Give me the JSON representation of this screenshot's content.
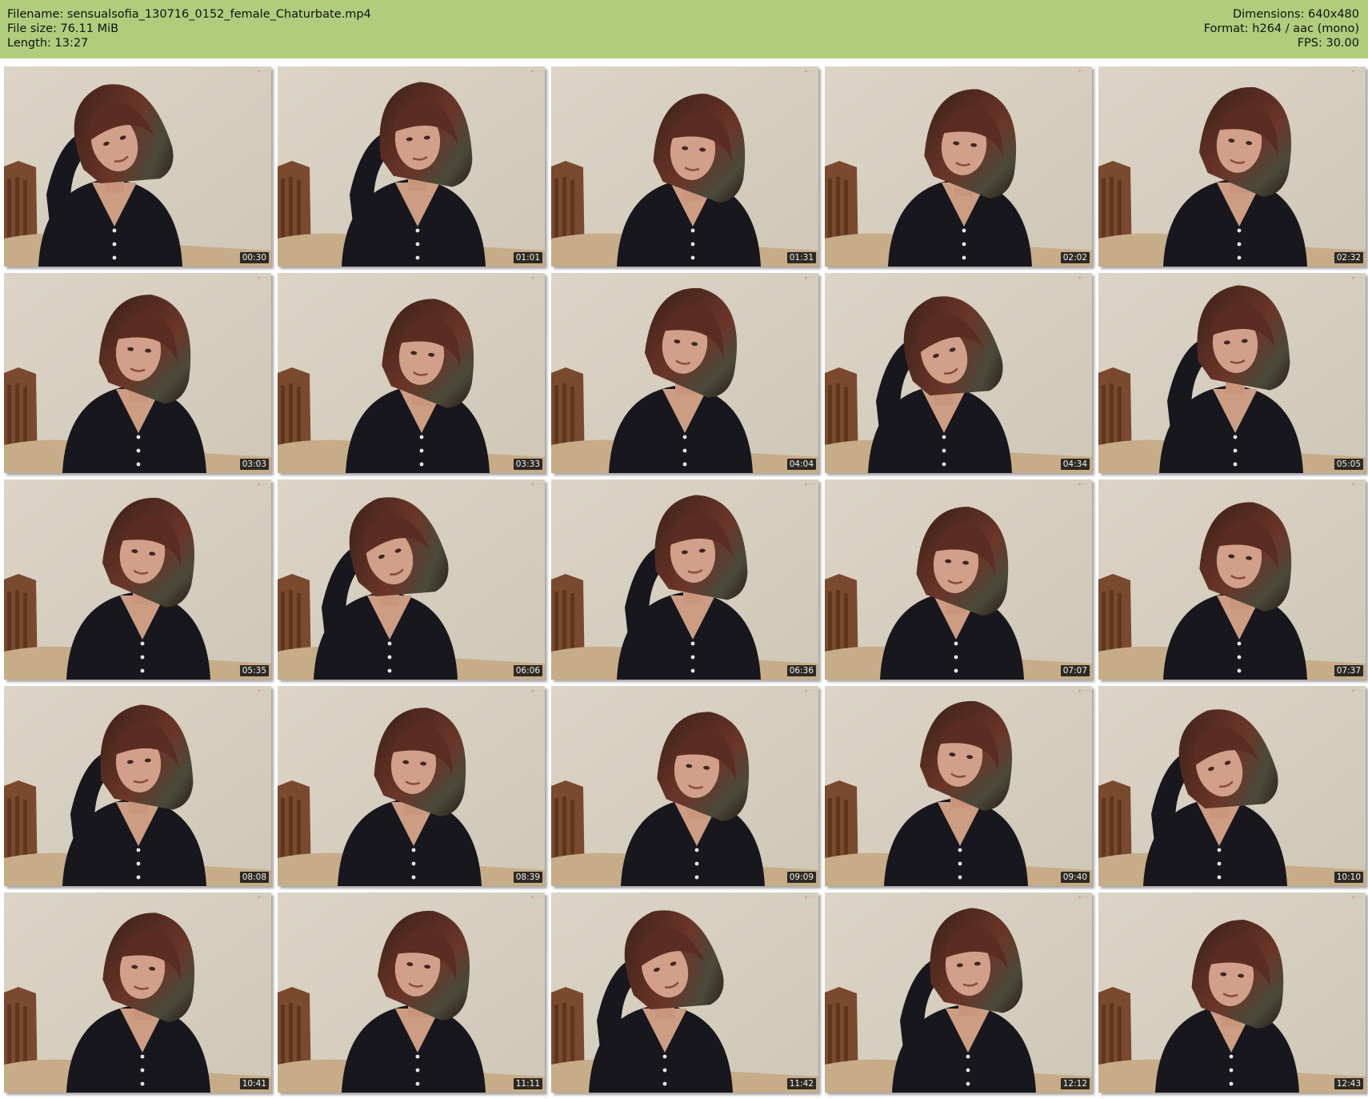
{
  "header": {
    "left": [
      "Filename: sensualsofia_130716_0152_female_Chaturbate.mp4",
      "File size: 76.11 MiB",
      "Length: 13:27"
    ],
    "right": [
      "Dimensions: 640x480",
      "Format: h264 / aac (mono)",
      "FPS: 30.00"
    ]
  },
  "thumbnails": [
    {
      "time": "00:30"
    },
    {
      "time": "01:01"
    },
    {
      "time": "01:31"
    },
    {
      "time": "02:02"
    },
    {
      "time": "02:32"
    },
    {
      "time": "03:03"
    },
    {
      "time": "03:33"
    },
    {
      "time": "04:04"
    },
    {
      "time": "04:34"
    },
    {
      "time": "05:05"
    },
    {
      "time": "05:35"
    },
    {
      "time": "06:06"
    },
    {
      "time": "06:36"
    },
    {
      "time": "07:07"
    },
    {
      "time": "07:37"
    },
    {
      "time": "08:08"
    },
    {
      "time": "08:39"
    },
    {
      "time": "09:09"
    },
    {
      "time": "09:40"
    },
    {
      "time": "10:10"
    },
    {
      "time": "10:41"
    },
    {
      "time": "11:11"
    },
    {
      "time": "11:42"
    },
    {
      "time": "12:12"
    },
    {
      "time": "12:43"
    }
  ]
}
